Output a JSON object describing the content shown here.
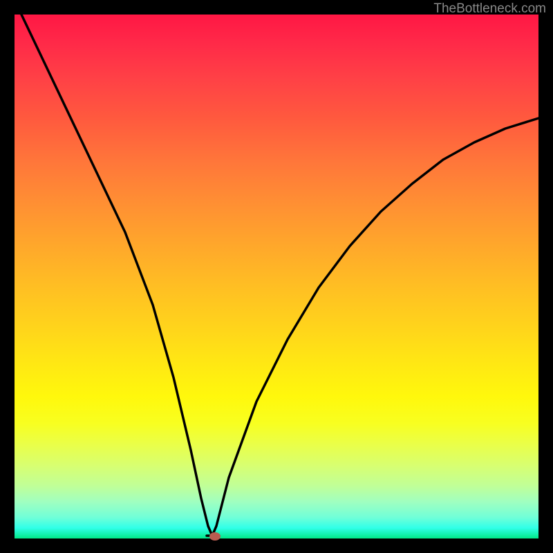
{
  "watermark": "TheBottleneck.com",
  "chart_data": {
    "type": "line",
    "title": "",
    "xlabel": "",
    "ylabel": "",
    "xlim": [
      0,
      100
    ],
    "ylim": [
      0,
      100
    ],
    "background_gradient": {
      "direction": "vertical",
      "stops": [
        {
          "pos": 0,
          "color": "#ff1744"
        },
        {
          "pos": 50,
          "color": "#ffd21c"
        },
        {
          "pos": 80,
          "color": "#f8ff20"
        },
        {
          "pos": 100,
          "color": "#00e888"
        }
      ]
    },
    "series": [
      {
        "name": "bottleneck-curve",
        "x": [
          0,
          5,
          10,
          15,
          20,
          25,
          30,
          33,
          35,
          36,
          37,
          40,
          45,
          50,
          55,
          60,
          65,
          70,
          75,
          80,
          85,
          90,
          95,
          100
        ],
        "y": [
          100,
          86,
          72,
          58,
          44,
          30,
          16,
          7,
          2,
          0,
          2,
          12,
          26,
          38,
          48,
          56,
          62,
          68,
          72,
          75,
          78,
          80,
          82,
          83
        ]
      }
    ],
    "marker": {
      "x": 36,
      "y": 0,
      "color": "#b85c50"
    }
  }
}
